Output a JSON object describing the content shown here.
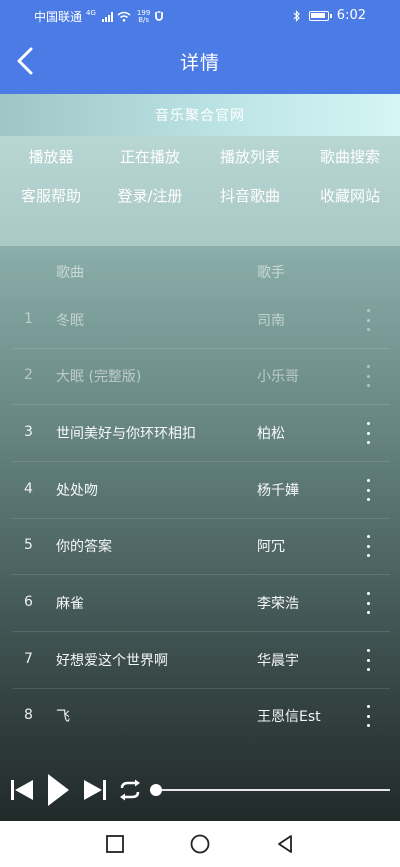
{
  "status_bar": {
    "carrier": "中国联通",
    "network": "4G",
    "speed_value": "199",
    "speed_unit": "B/s",
    "time": "6:02"
  },
  "header": {
    "title": "详情",
    "back_icon": "chevron-left-icon"
  },
  "site": {
    "title": "音乐聚合官网"
  },
  "nav": {
    "items": [
      {
        "label": "播放器"
      },
      {
        "label": "正在播放"
      },
      {
        "label": "播放列表"
      },
      {
        "label": "歌曲搜索"
      },
      {
        "label": "客服帮助"
      },
      {
        "label": "登录/注册"
      },
      {
        "label": "抖音歌曲"
      },
      {
        "label": "收藏网站"
      }
    ]
  },
  "song_list": {
    "columns": {
      "song": "歌曲",
      "artist": "歌手"
    },
    "rows": [
      {
        "index": "1",
        "song": "冬眠",
        "artist": "司南"
      },
      {
        "index": "2",
        "song": "大眠 (完整版)",
        "artist": "小乐哥"
      },
      {
        "index": "3",
        "song": "世间美好与你环环相扣",
        "artist": "柏松"
      },
      {
        "index": "4",
        "song": "处处吻",
        "artist": "杨千嬅"
      },
      {
        "index": "5",
        "song": "你的答案",
        "artist": "阿冗"
      },
      {
        "index": "6",
        "song": "麻雀",
        "artist": "李荣浩"
      },
      {
        "index": "7",
        "song": "好想爱这个世界啊",
        "artist": "华晨宇"
      },
      {
        "index": "8",
        "song": "飞",
        "artist": "王恩信Est"
      }
    ]
  },
  "player": {
    "progress": 0,
    "controls": [
      "skip-previous-icon",
      "play-icon",
      "skip-next-icon",
      "repeat-icon"
    ]
  },
  "system_nav": [
    "recents-square-icon",
    "home-circle-icon",
    "back-triangle-icon"
  ],
  "colors": {
    "accent": "#4b7be5",
    "text": "#ffffff"
  }
}
